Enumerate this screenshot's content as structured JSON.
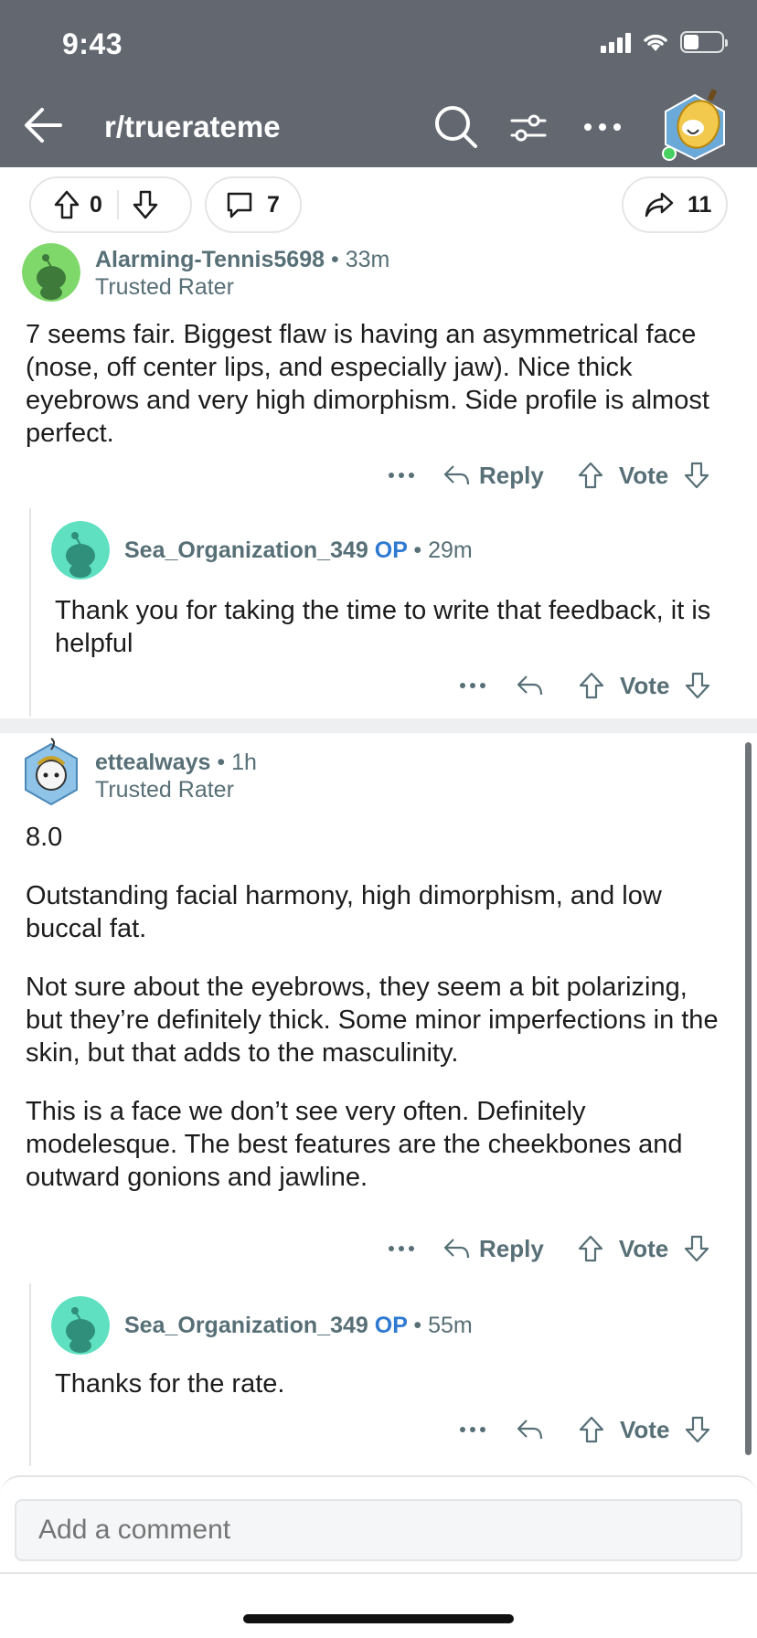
{
  "status_bar": {
    "time": "9:43"
  },
  "nav": {
    "title": "r/truerateme"
  },
  "post_bar": {
    "vote_count": "0",
    "comment_count": "7",
    "share_count": "11"
  },
  "comments": [
    {
      "author": "Alarming-Tennis5698",
      "separator": "•",
      "time": "33m",
      "flair": "Trusted Rater",
      "paragraphs": [
        "7 seems fair. Biggest flaw is having an asymmetrical face (nose, off center lips, and especially jaw). Nice thick eyebrows and very high dimorphism. Side profile is almost perfect."
      ],
      "reply_label": "Reply",
      "vote_label": "Vote"
    },
    {
      "author": "Sea_Organization_349",
      "op_badge": "OP",
      "separator": "•",
      "time": "29m",
      "paragraphs": [
        "Thank you for taking the time to write that feedback, it is helpful"
      ],
      "vote_label": "Vote"
    },
    {
      "author": "ettealways",
      "separator": "•",
      "time": "1h",
      "flair": "Trusted Rater",
      "paragraphs": [
        "8.0",
        "Outstanding facial harmony, high dimorphism, and low buccal fat.",
        "Not sure about the eyebrows, they seem a bit polarizing, but they’re definitely thick. Some minor imperfections in the skin, but that adds to the masculinity.",
        "This is a face we don’t see very often. Definitely modelesque. The best features are the cheekbones and outward gonions and jawline."
      ],
      "reply_label": "Reply",
      "vote_label": "Vote"
    },
    {
      "author": "Sea_Organization_349",
      "op_badge": "OP",
      "separator": "•",
      "time": "55m",
      "paragraphs": [
        "Thanks for the rate."
      ],
      "vote_label": "Vote"
    }
  ],
  "composer": {
    "placeholder": "Add a comment"
  },
  "colors": {
    "header_bg": "#636870",
    "op_blue": "#2f7ad1",
    "meta_gray": "#576f76",
    "avatar_green": "#7fd86a",
    "avatar_teal": "#5fe0c0"
  },
  "icons": [
    "back-arrow-icon",
    "search-icon",
    "filter-icon",
    "more-icon",
    "upvote-icon",
    "downvote-icon",
    "comment-icon",
    "share-icon",
    "reply-icon"
  ]
}
